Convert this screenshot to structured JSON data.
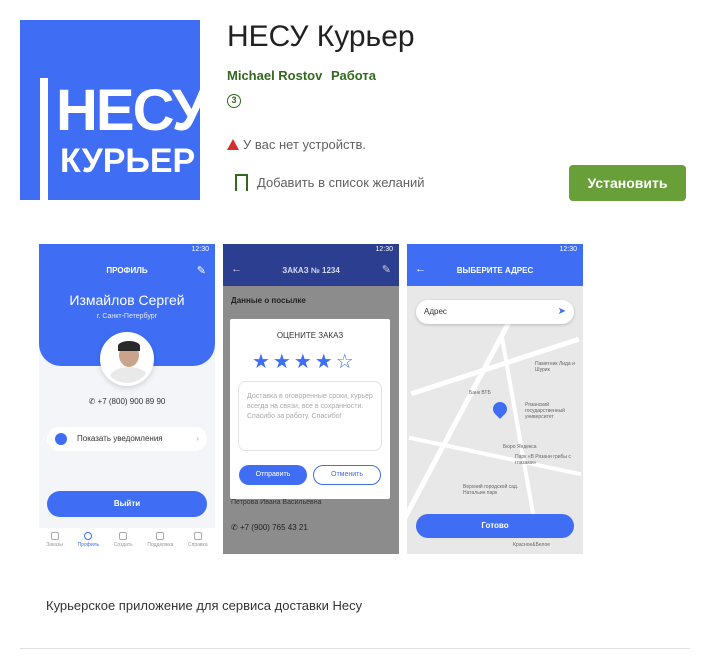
{
  "app": {
    "icon": {
      "line1": "НЕСУ",
      "line2": "КУРЬЕР"
    },
    "title": "НЕСУ Курьер",
    "developer": "Michael Rostov",
    "category": "Работа",
    "content_rating": "3",
    "warning_text": "У вас нет устройств.",
    "wishlist_label": "Добавить в список желаний",
    "install_label": "Установить",
    "description": "Курьерское приложение для сервиса доставки Несу"
  },
  "screenshots": {
    "status_time": "12:30",
    "profile": {
      "title": "ПРОФИЛЬ",
      "name": "Измайлов Сергей",
      "city": "г. Санкт-Петербург",
      "phone": "+7 (800) 900 89 90",
      "notifications": "Показать уведомления",
      "logout": "Выйти",
      "tabs": [
        "Заказы",
        "Профиль",
        "Создать",
        "Поддержка",
        "Справка"
      ]
    },
    "order": {
      "title": "ЗАКАЗ № 1234",
      "section": "Данные о посылке",
      "modal_title": "ОЦЕНИТЕ ЗАКАЗ",
      "stars": "★★★★☆",
      "feedback": "Доставка в оговоренные сроки, курьер всегда на связи, все в сохранности. Спасибо за работу. Спасибо!",
      "send": "Отправить",
      "cancel": "Отменить",
      "recipient": "Петрова Ивана Васильевна",
      "phone": "+7 (900) 765 43 21"
    },
    "address": {
      "title": "ВЫБЕРИТЕ АДРЕС",
      "input_placeholder": "Адрес",
      "done": "Готово",
      "map_labels": [
        "Памятник Лида и Шурик",
        "Банк ВТБ",
        "Рязанский государственный университет",
        "Бюро Яндекса",
        "Парк «В Рязани грибы с глазами»",
        "Верхний городской сад. Натальин парк",
        "Красное&Белое"
      ]
    }
  },
  "colors": {
    "brand_blue": "#3f6ef5",
    "install_green": "#689f38",
    "dev_green": "#33691e"
  }
}
